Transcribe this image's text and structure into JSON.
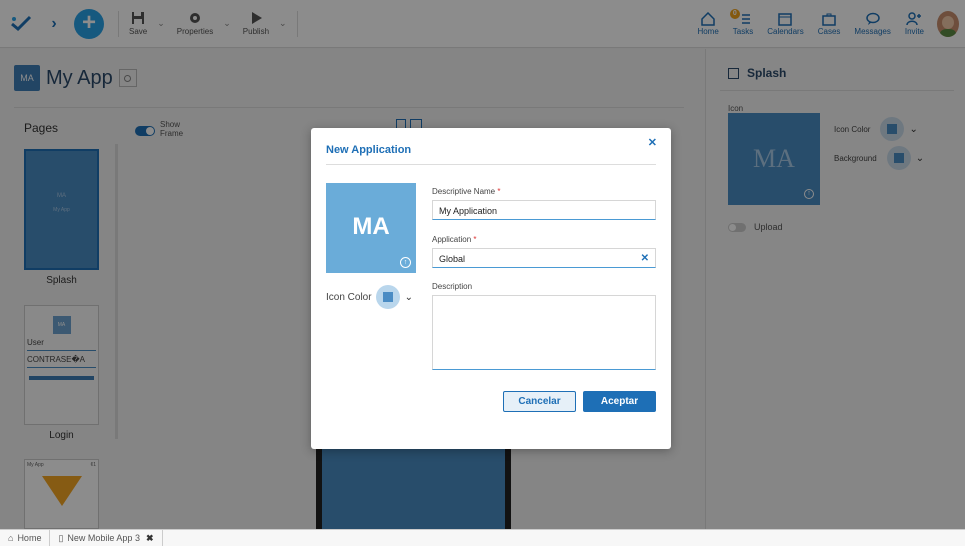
{
  "toolbar": {
    "save_label": "Save",
    "properties_label": "Properties",
    "publish_label": "Publish"
  },
  "nav": {
    "home": "Home",
    "tasks": "Tasks",
    "tasks_badge": "0",
    "calendars": "Calendars",
    "cases": "Cases",
    "messages": "Messages",
    "invite": "Invite"
  },
  "app": {
    "initials": "MA",
    "title": "My App"
  },
  "pages": {
    "title": "Pages",
    "splash_label": "Splash",
    "splash_thumb_initials": "MA",
    "splash_thumb_app": "My App",
    "login_label": "Login",
    "login_thumb_initials": "MA",
    "login_user": "User",
    "login_password": "CONTRASE�A",
    "third_thumb_title": "My App",
    "third_thumb_count": "¢1"
  },
  "canvas": {
    "show_frame_line1": "Show",
    "show_frame_line2": "Frame"
  },
  "right_panel": {
    "title": "Splash",
    "icon_label": "Icon",
    "icon_initials": "MA",
    "icon_color_label": "Icon Color",
    "background_label": "Background",
    "upload_label": "Upload"
  },
  "modal": {
    "title": "New Application",
    "initials": "MA",
    "icon_color_label": "Icon Color",
    "descriptive_name_label": "Descriptive Name",
    "descriptive_name_value": "My Application",
    "application_label": "Application",
    "application_value": "Global",
    "description_label": "Description",
    "cancel_label": "Cancelar",
    "accept_label": "Aceptar",
    "required_mark": "*"
  },
  "bottom_tabs": {
    "home": "Home",
    "current": "New Mobile App 3"
  },
  "colors": {
    "accent": "#1e6fb6",
    "icon_bg": "#4a8cc4",
    "plus_button": "#29a3e8",
    "badge": "#f0a31c"
  }
}
